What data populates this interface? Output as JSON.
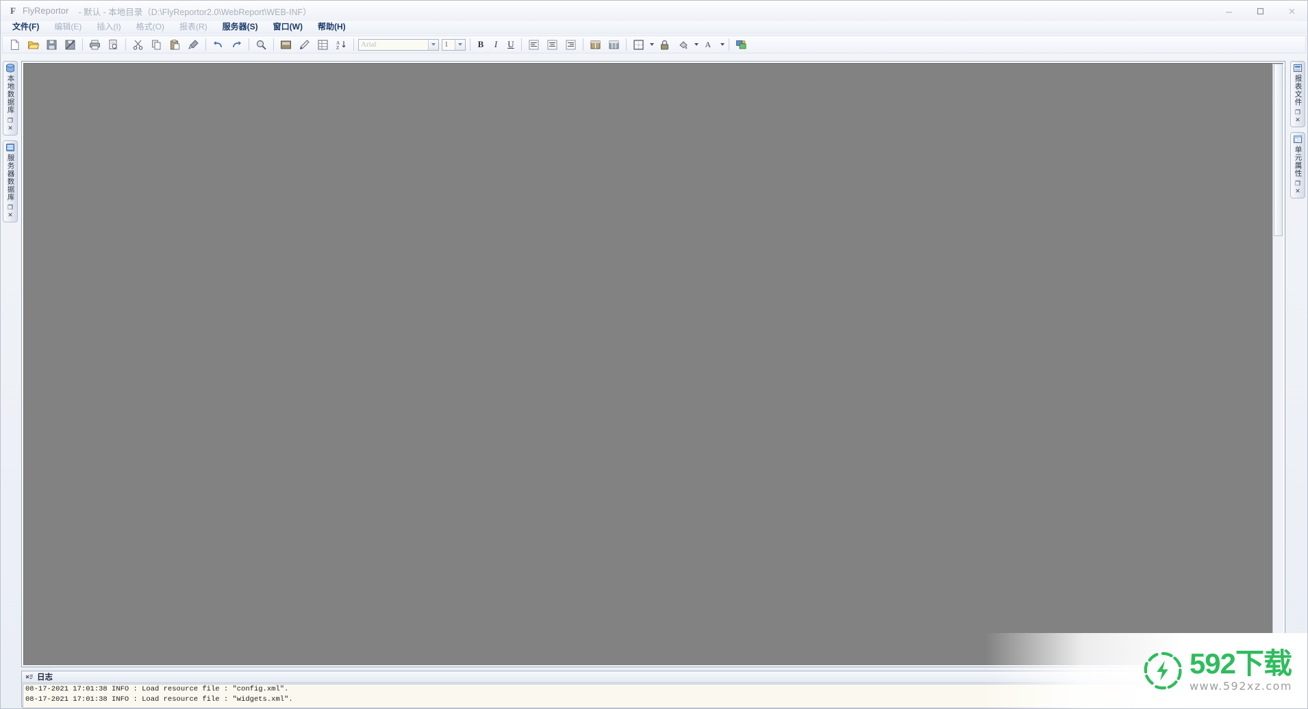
{
  "window": {
    "app_icon": "F",
    "app_name": "FlyReportor",
    "subtitle": "- 默认 - 本地目录（D:\\FlyReportor2.0\\WebReport\\WEB-INF）",
    "controls": {
      "minimize": "minimize-icon",
      "maximize": "maximize-icon",
      "close": "close-icon"
    }
  },
  "menubar": {
    "items": [
      {
        "label": "文件(F)",
        "enabled": true
      },
      {
        "label": "编辑(E)",
        "enabled": false
      },
      {
        "label": "插入(I)",
        "enabled": false
      },
      {
        "label": "格式(O)",
        "enabled": false
      },
      {
        "label": "报表(R)",
        "enabled": false
      },
      {
        "label": "服务器(S)",
        "enabled": true
      },
      {
        "label": "窗口(W)",
        "enabled": true
      },
      {
        "label": "帮助(H)",
        "enabled": true
      }
    ]
  },
  "toolbar": {
    "buttons": [
      {
        "name": "new-file-icon",
        "title": "新建"
      },
      {
        "name": "open-folder-icon",
        "title": "打开"
      },
      {
        "name": "save-icon",
        "title": "保存"
      },
      {
        "name": "save-as-icon",
        "title": "另存为"
      },
      {
        "name": "print-icon",
        "title": "打印"
      },
      {
        "name": "print-preview-icon",
        "title": "打印预览"
      },
      {
        "name": "cut-icon",
        "title": "剪切"
      },
      {
        "name": "copy-icon",
        "title": "复制"
      },
      {
        "name": "paste-icon",
        "title": "粘贴"
      },
      {
        "name": "format-painter-icon",
        "title": "格式刷"
      },
      {
        "name": "undo-icon",
        "title": "撤销"
      },
      {
        "name": "redo-icon",
        "title": "重做"
      },
      {
        "name": "zoom-icon",
        "title": "缩放"
      },
      {
        "name": "insert-image-icon",
        "title": "插入图片"
      },
      {
        "name": "pen-icon",
        "title": "画笔"
      },
      {
        "name": "table-insert-icon",
        "title": "插入表格"
      },
      {
        "name": "sort-icon",
        "title": "排序"
      }
    ],
    "font_family": {
      "value": "Arial",
      "placeholder": "Arial"
    },
    "font_size": {
      "value": "1",
      "placeholder": "1"
    },
    "bold": "B",
    "italic": "I",
    "underline": "U",
    "align_left": "align-left-icon",
    "align_center": "align-center-icon",
    "align_right": "align-right-icon",
    "merge_cells": "merge-cells-icon",
    "split_cells": "split-cells-icon",
    "borders": "borders-icon",
    "lock": "lock-icon",
    "fill_color": "fill-color-icon",
    "font_color_letter": "A",
    "image_tool": "image-tool-icon"
  },
  "left_dock": {
    "panels": [
      {
        "label": "本地数据库",
        "icon": "database-icon",
        "restore": "❐",
        "close": "✕"
      },
      {
        "label": "服务器数据库",
        "icon": "server-database-icon",
        "restore": "❐",
        "close": "✕"
      }
    ]
  },
  "right_dock": {
    "panels": [
      {
        "label": "报表文件",
        "icon": "report-file-icon",
        "restore": "❐",
        "close": "✕"
      },
      {
        "label": "单元属性",
        "icon": "cell-property-icon",
        "restore": "❐",
        "close": "✕"
      }
    ]
  },
  "canvas": {
    "background_color": "#828282",
    "scrollbar": "vertical-scrollbar"
  },
  "log_panel": {
    "icon": "log-icon",
    "title": "日志",
    "lines": [
      "08-17-2021 17:01:38 INFO : Load resource file : \"config.xml\".",
      "08-17-2021 17:01:38 INFO : Load resource file : \"widgets.xml\"."
    ]
  },
  "watermark": {
    "main_text": "592下载",
    "sub_text": "www.592xz.com",
    "color": "#2fbc5d",
    "icon": "lightning-ring-icon"
  }
}
